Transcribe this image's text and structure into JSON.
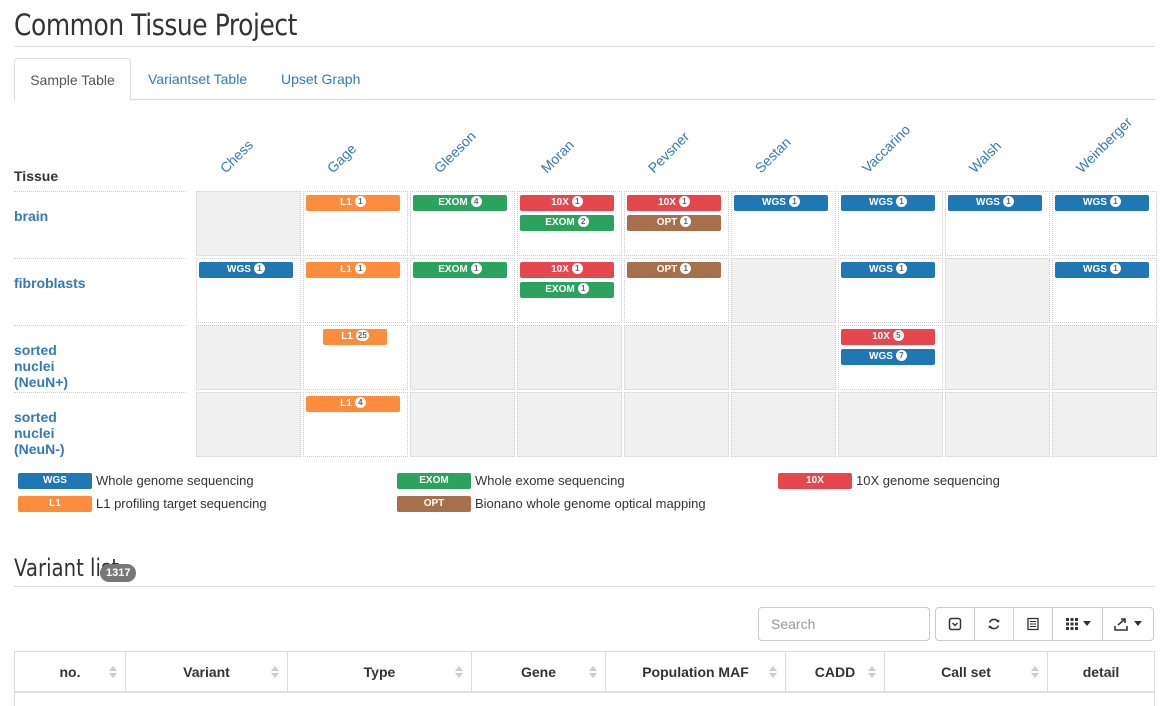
{
  "page": {
    "title": "Common Tissue Project"
  },
  "tabs": [
    {
      "label": "Sample Table",
      "active": true
    },
    {
      "label": "Variantset Table",
      "active": false
    },
    {
      "label": "Upset Graph",
      "active": false
    }
  ],
  "sample_table": {
    "row_header": "Tissue",
    "labs": [
      "Chess",
      "Gage",
      "Gleeson",
      "Moran",
      "Pevsner",
      "Sestan",
      "Vaccarino",
      "Walsh",
      "Weinberger"
    ],
    "rows": [
      {
        "tissue": "brain",
        "cells": [
          [],
          [
            {
              "type": "L1",
              "count": "1"
            }
          ],
          [
            {
              "type": "EXOM",
              "count": "4"
            }
          ],
          [
            {
              "type": "10X",
              "count": "1"
            },
            {
              "type": "EXOM",
              "count": "2"
            }
          ],
          [
            {
              "type": "10X",
              "count": "1"
            },
            {
              "type": "OPT",
              "count": "1"
            }
          ],
          [
            {
              "type": "WGS",
              "count": "1"
            }
          ],
          [
            {
              "type": "WGS",
              "count": "1"
            }
          ],
          [
            {
              "type": "WGS",
              "count": "1"
            }
          ],
          [
            {
              "type": "WGS",
              "count": "1"
            }
          ]
        ]
      },
      {
        "tissue": "fibroblasts",
        "cells": [
          [
            {
              "type": "WGS",
              "count": "1"
            }
          ],
          [
            {
              "type": "L1",
              "count": "1"
            }
          ],
          [
            {
              "type": "EXOM",
              "count": "1"
            }
          ],
          [
            {
              "type": "10X",
              "count": "1"
            },
            {
              "type": "EXOM",
              "count": "1"
            }
          ],
          [
            {
              "type": "OPT",
              "count": "1"
            }
          ],
          [],
          [
            {
              "type": "WGS",
              "count": "1"
            }
          ],
          [],
          [
            {
              "type": "WGS",
              "count": "1"
            }
          ]
        ]
      },
      {
        "tissue": "sorted nuclei (NeuN+)",
        "cells": [
          [],
          [
            {
              "type": "L1",
              "count": "25"
            }
          ],
          [],
          [],
          [],
          [],
          [
            {
              "type": "10X",
              "count": "5"
            },
            {
              "type": "WGS",
              "count": "7"
            }
          ],
          [],
          []
        ]
      },
      {
        "tissue": "sorted nuclei (NeuN-)",
        "cells": [
          [],
          [
            {
              "type": "L1",
              "count": "4"
            }
          ],
          [],
          [],
          [],
          [],
          [],
          [],
          []
        ]
      }
    ]
  },
  "legend": [
    {
      "code": "WGS",
      "text": "Whole genome sequencing"
    },
    {
      "code": "EXOM",
      "text": "Whole exome sequencing"
    },
    {
      "code": "10X",
      "text": "10X genome sequencing"
    },
    {
      "code": "L1",
      "text": "L1 profiling target sequencing"
    },
    {
      "code": "OPT",
      "text": "Bionano whole genome optical mapping"
    }
  ],
  "colors": {
    "WGS": "#1f77b4",
    "EXOM": "#2ca25f",
    "10X": "#e5474f",
    "L1": "#fd8d3c",
    "OPT": "#a6704c"
  },
  "variant_list": {
    "title": "Variant list",
    "count": "1317",
    "search_placeholder": "Search",
    "toolbar": [
      {
        "icon": "toggle-icon"
      },
      {
        "icon": "refresh-icon"
      },
      {
        "icon": "list-icon"
      },
      {
        "icon": "columns-icon"
      },
      {
        "icon": "export-icon"
      }
    ],
    "columns": [
      "no.",
      "Variant",
      "Type",
      "Gene",
      "Population MAF",
      "CADD",
      "Call set",
      "detail"
    ]
  }
}
